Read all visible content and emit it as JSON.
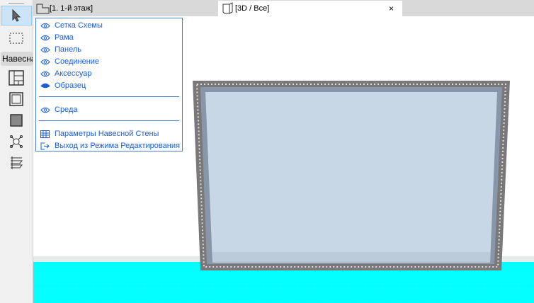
{
  "toolbar": {
    "section_label": "Навесна"
  },
  "tabs": [
    {
      "label": "[1. 1-й этаж]",
      "icon": "floor-plan-icon"
    },
    {
      "label": "[3D / Все]",
      "icon": "3d-box-icon",
      "close": "×"
    }
  ],
  "menu": {
    "items": [
      {
        "label": "Сетка Схемы",
        "icon": "eye-icon"
      },
      {
        "label": "Рама",
        "icon": "eye-icon"
      },
      {
        "label": "Панель",
        "icon": "eye-icon"
      },
      {
        "label": "Соединение",
        "icon": "eye-icon"
      },
      {
        "label": "Аксессуар",
        "icon": "eye-icon"
      },
      {
        "label": "Образец",
        "icon": "eye-closed-icon"
      }
    ],
    "env": {
      "label": "Среда",
      "icon": "eye-icon"
    },
    "actions": [
      {
        "label": "Параметры Навесной Стены",
        "icon": "curtain-wall-settings-icon"
      },
      {
        "label": "Выход из Режима Редактирования",
        "icon": "exit-icon"
      }
    ]
  },
  "colors": {
    "accent": "#1a5fd6",
    "floor": "#00ffff",
    "glass": "#c8d7e6",
    "frame": "#7a7a7a"
  }
}
